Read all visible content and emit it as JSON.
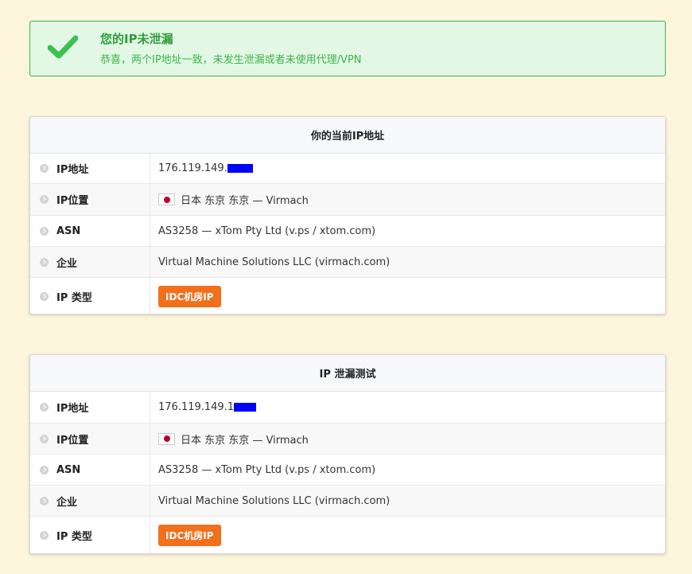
{
  "alert": {
    "title": "您的IP未泄漏",
    "description": "恭喜，两个IP地址一致，未发生泄漏或者未使用代理/VPN",
    "color": "#3cb54a"
  },
  "cards": [
    {
      "title": "你的当前IP地址",
      "rows": [
        {
          "label": "IP地址",
          "value": "176.119.149."
        },
        {
          "label": "IP位置",
          "value": "日本 东京 东京 — Virmach"
        },
        {
          "label": "ASN",
          "value": "AS3258 — xTom Pty Ltd (v.ps / xtom.com)"
        },
        {
          "label": "企业",
          "value": "Virtual Machine Solutions LLC (virmach.com)"
        },
        {
          "label": "IP 类型",
          "value": "IDC机房IP"
        }
      ]
    },
    {
      "title": "IP 泄漏测试",
      "rows": [
        {
          "label": "IP地址",
          "value": "176.119.149.1"
        },
        {
          "label": "IP位置",
          "value": "日本 东京 东京 — Virmach"
        },
        {
          "label": "ASN",
          "value": "AS3258 — xTom Pty Ltd (v.ps / xtom.com)"
        },
        {
          "label": "企业",
          "value": "Virtual Machine Solutions LLC (virmach.com)"
        },
        {
          "label": "IP 类型",
          "value": "IDC机房IP"
        }
      ]
    }
  ],
  "icons": {
    "check": "check-icon",
    "row_bullet": "chevron-right-circle-icon",
    "flag": "japan-flag-icon"
  },
  "colors": {
    "background": "#fdf6dc",
    "success": "#3cb54a",
    "badge": "#f26f1c",
    "redaction": "#0000ff"
  }
}
